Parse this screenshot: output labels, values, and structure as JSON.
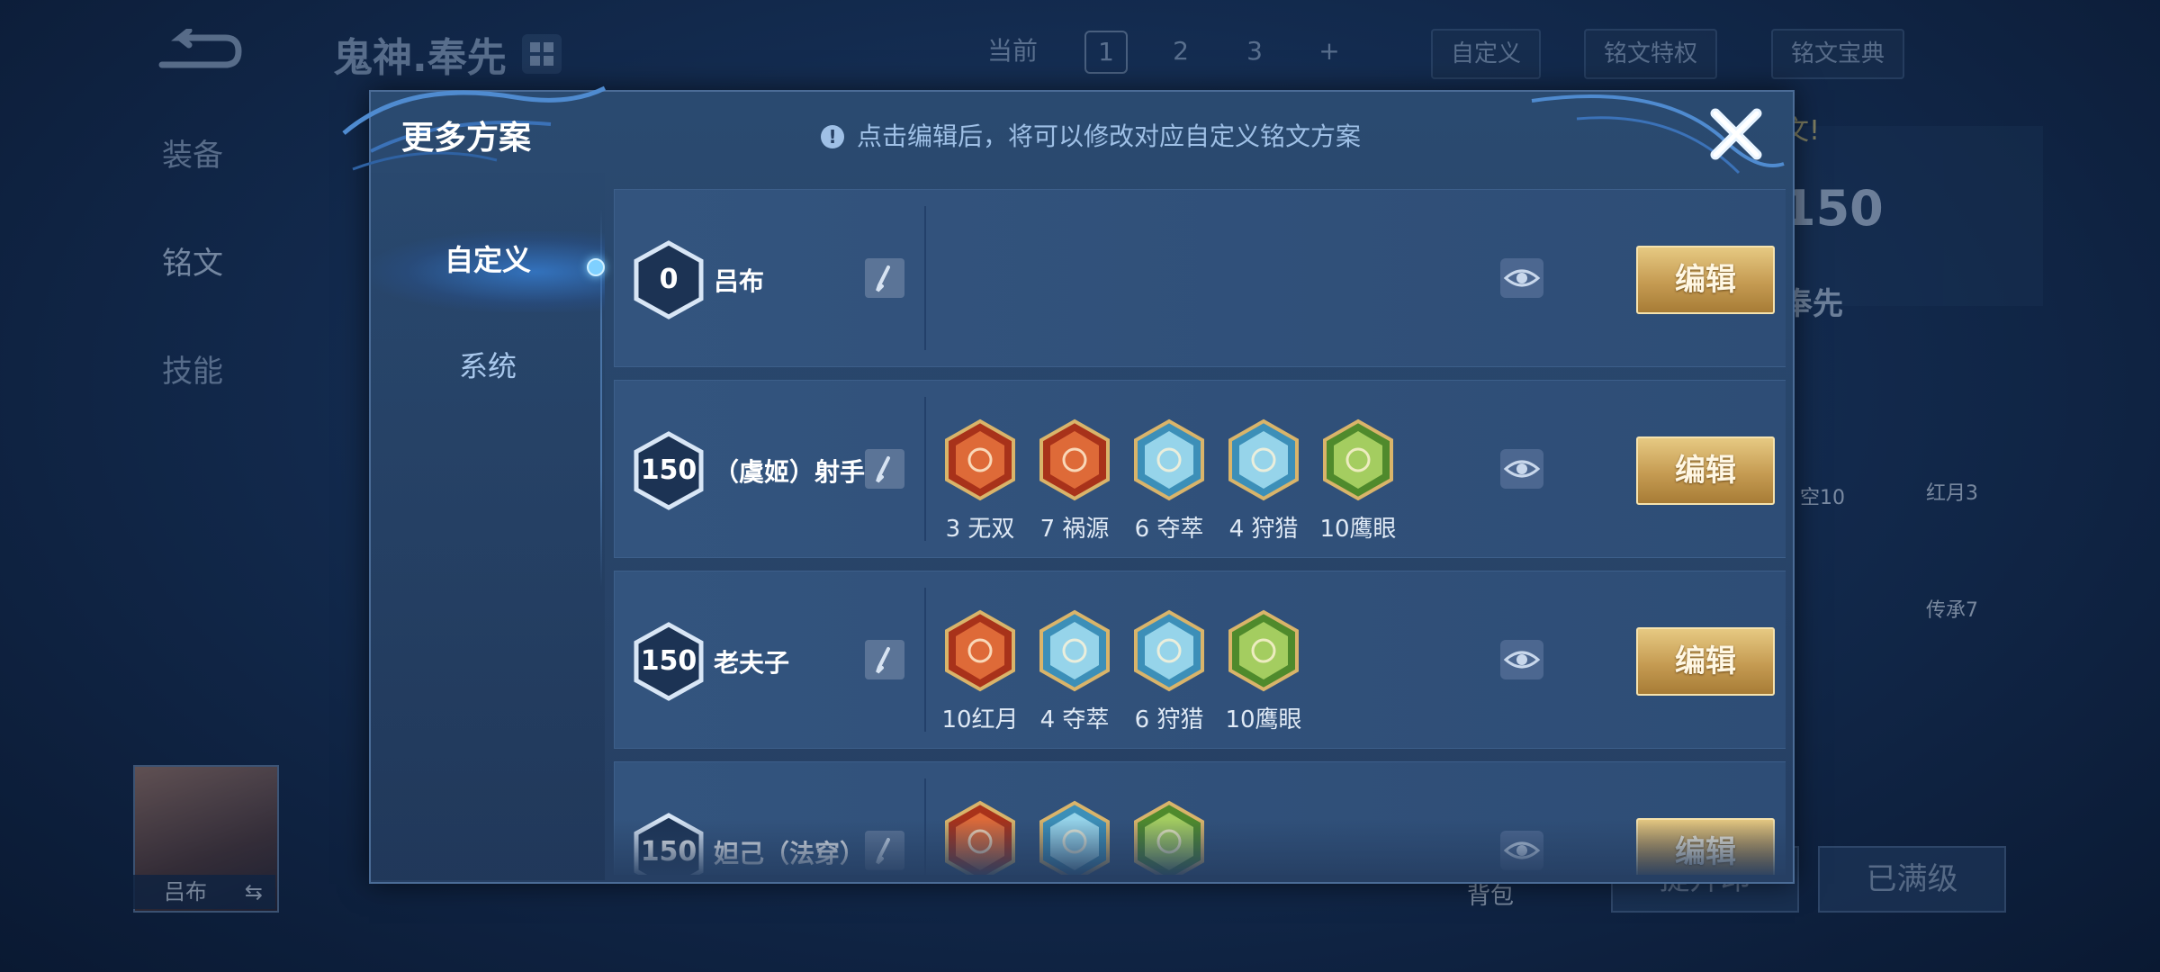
{
  "background": {
    "hero_title": "鬼神.奉先",
    "topbar": {
      "current_label": "当前",
      "pages": [
        "1",
        "2",
        "3"
      ],
      "add_label": "+",
      "custom_label": "自定义",
      "special_label": "铭文特权",
      "codex_label": "铭文宝典"
    },
    "side_tabs": [
      "装备",
      "铭文",
      "技能"
    ],
    "hero_card": {
      "level": "150",
      "name": "奉先",
      "hint": "文!"
    },
    "right_runes": [
      "空10",
      "红月3",
      "传承7"
    ],
    "avatar_name": "吕布",
    "bag_label": "背包",
    "upgrade_label": "提升印",
    "maxed_label": "已满级"
  },
  "modal": {
    "title": "更多方案",
    "hint": "点击编辑后，将可以修改对应自定义铭文方案",
    "hint_icon": "exclamation-icon",
    "tabs": [
      {
        "label": "自定义",
        "active": true
      },
      {
        "label": "系统",
        "active": false
      }
    ],
    "edit_label": "编辑",
    "schemes": [
      {
        "level": "0",
        "name": "吕布",
        "runes": []
      },
      {
        "level": "150",
        "name": "（虞姬）射手",
        "runes": [
          {
            "label": "3 无双",
            "color": "red"
          },
          {
            "label": "7 祸源",
            "color": "red"
          },
          {
            "label": "6 夺萃",
            "color": "blue"
          },
          {
            "label": "4 狩猎",
            "color": "blue"
          },
          {
            "label": "10鹰眼",
            "color": "green"
          }
        ]
      },
      {
        "level": "150",
        "name": "老夫子",
        "runes": [
          {
            "label": "10红月",
            "color": "red"
          },
          {
            "label": "4 夺萃",
            "color": "blue"
          },
          {
            "label": "6 狩猎",
            "color": "blue"
          },
          {
            "label": "10鹰眼",
            "color": "green"
          }
        ]
      },
      {
        "level": "150",
        "name": "妲己（法穿）",
        "runes": [
          {
            "label": "",
            "color": "red"
          },
          {
            "label": "",
            "color": "blue"
          },
          {
            "label": "",
            "color": "green"
          }
        ]
      }
    ]
  },
  "colors": {
    "gold": "#c9a25a",
    "rune_red": "#c94a24",
    "rune_blue": "#5ab4d8",
    "rune_green": "#7fb84a",
    "panel": "#263f63"
  }
}
